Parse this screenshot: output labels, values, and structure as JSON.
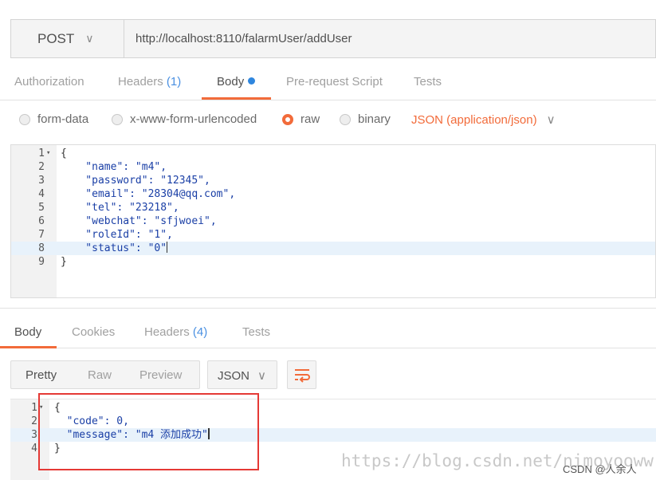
{
  "request": {
    "method": "POST",
    "url": "http://localhost:8110/falarmUser/addUser"
  },
  "request_tabs": [
    {
      "label": "Authorization"
    },
    {
      "label": "Headers",
      "count": "(1)"
    },
    {
      "label": "Body",
      "active": true
    },
    {
      "label": "Pre-request Script"
    },
    {
      "label": "Tests"
    }
  ],
  "body_types": [
    {
      "label": "form-data",
      "selected": false
    },
    {
      "label": "x-www-form-urlencoded",
      "selected": false
    },
    {
      "label": "raw",
      "selected": true
    },
    {
      "label": "binary",
      "selected": false
    }
  ],
  "body_format": "JSON (application/json)",
  "request_body": {
    "line_numbers": [
      "1",
      "2",
      "3",
      "4",
      "5",
      "6",
      "7",
      "8",
      "9"
    ],
    "lines": [
      "{",
      "    \"name\": \"m4\",",
      "    \"password\": \"12345\",",
      "    \"email\": \"28304@qq.com\",",
      "    \"tel\": \"23218\",",
      "    \"webchat\": \"sfjwoei\",",
      "    \"roleId\": \"1\",",
      "    \"status\": \"0\"",
      "}"
    ],
    "highlighted_line": "8"
  },
  "response_tabs": [
    {
      "label": "Body",
      "active": true
    },
    {
      "label": "Cookies"
    },
    {
      "label": "Headers",
      "count": "(4)"
    },
    {
      "label": "Tests"
    }
  ],
  "response_view": {
    "modes": [
      "Pretty",
      "Raw",
      "Preview"
    ],
    "active_mode": "Pretty",
    "format": "JSON",
    "wrap_icon": "wrap-lines-icon"
  },
  "response_body": {
    "line_numbers": [
      "1",
      "2",
      "3",
      "4"
    ],
    "lines": [
      "{",
      "  \"code\": 0,",
      "  \"message\": \"m4 添加成功\"",
      "}"
    ],
    "highlighted_line": "3"
  },
  "watermark": "https://blog.csdn.net/nimoyooww",
  "credit": "CSDN @人余人",
  "colors": {
    "accent": "#f26b3a",
    "active_dot": "#2e86de",
    "count": "#4a90e2",
    "json_key": "#1a3fa6",
    "highlight_box": "#e53935"
  }
}
